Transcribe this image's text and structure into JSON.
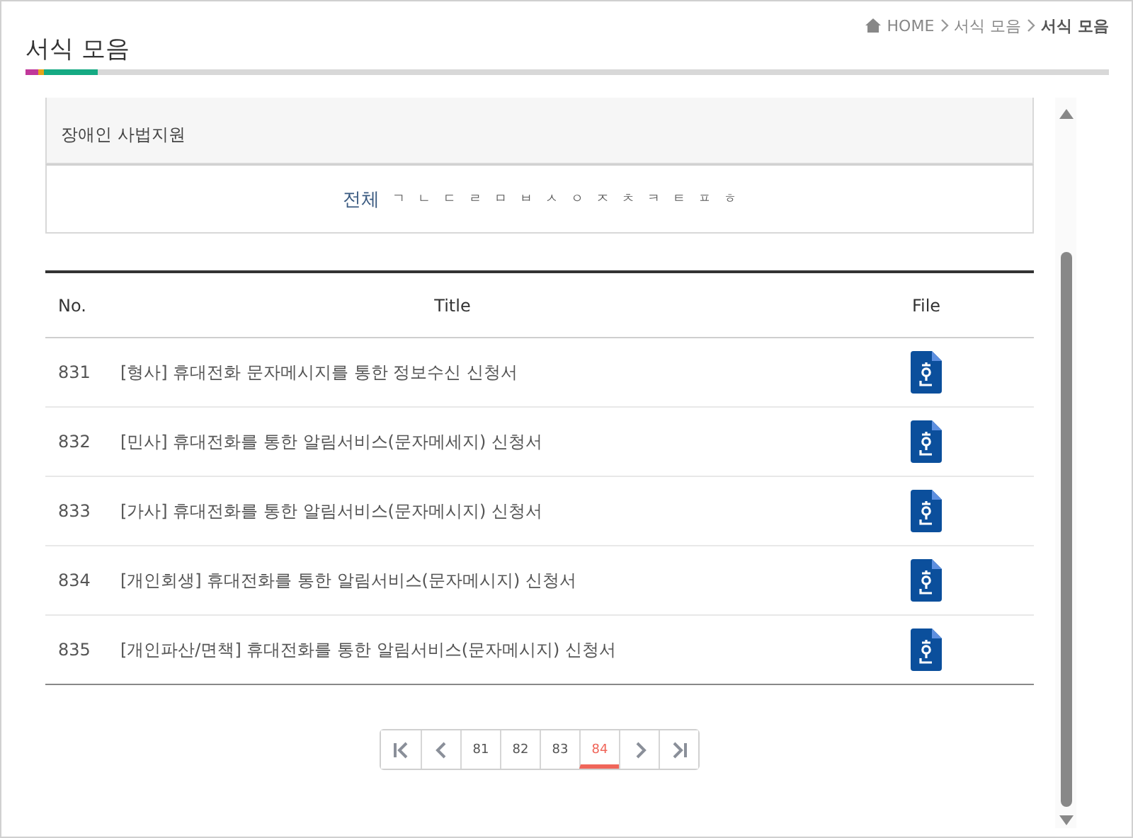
{
  "page_title": "서식 모음",
  "breadcrumb": [
    "HOME",
    "서식 모음",
    "서식 모음"
  ],
  "category": {
    "item": "장애인 사법지원"
  },
  "index": [
    {
      "label": "전체",
      "selected": true
    },
    {
      "label": "ㄱ",
      "selected": false
    },
    {
      "label": "ㄴ",
      "selected": false
    },
    {
      "label": "ㄷ",
      "selected": false
    },
    {
      "label": "ㄹ",
      "selected": false
    },
    {
      "label": "ㅁ",
      "selected": false
    },
    {
      "label": "ㅂ",
      "selected": false
    },
    {
      "label": "ㅅ",
      "selected": false
    },
    {
      "label": "ㅇ",
      "selected": false
    },
    {
      "label": "ㅈ",
      "selected": false
    },
    {
      "label": "ㅊ",
      "selected": false
    },
    {
      "label": "ㅋ",
      "selected": false
    },
    {
      "label": "ㅌ",
      "selected": false
    },
    {
      "label": "ㅍ",
      "selected": false
    },
    {
      "label": "ㅎ",
      "selected": false
    }
  ],
  "table": {
    "columns": [
      "No.",
      "Title",
      "File"
    ],
    "rows": [
      {
        "no": "831",
        "title": "[형사] 휴대전화 문자메시지를 통한 정보수신 신청서"
      },
      {
        "no": "832",
        "title": "[민사] 휴대전화를 통한 알림서비스(문자메세지) 신청서"
      },
      {
        "no": "833",
        "title": "[가사] 휴대전화를 통한 알림서비스(문자메시지) 신청서"
      },
      {
        "no": "834",
        "title": "[개인회생] 휴대전화를 통한 알림서비스(문자메시지) 신청서"
      },
      {
        "no": "835",
        "title": "[개인파산/면책] 휴대전화를 통한 알림서비스(문자메시지) 신청서"
      }
    ]
  },
  "pagination": {
    "pages": [
      {
        "label": "81",
        "selected": false
      },
      {
        "label": "82",
        "selected": false
      },
      {
        "label": "83",
        "selected": false
      },
      {
        "label": "84",
        "selected": true
      }
    ]
  }
}
